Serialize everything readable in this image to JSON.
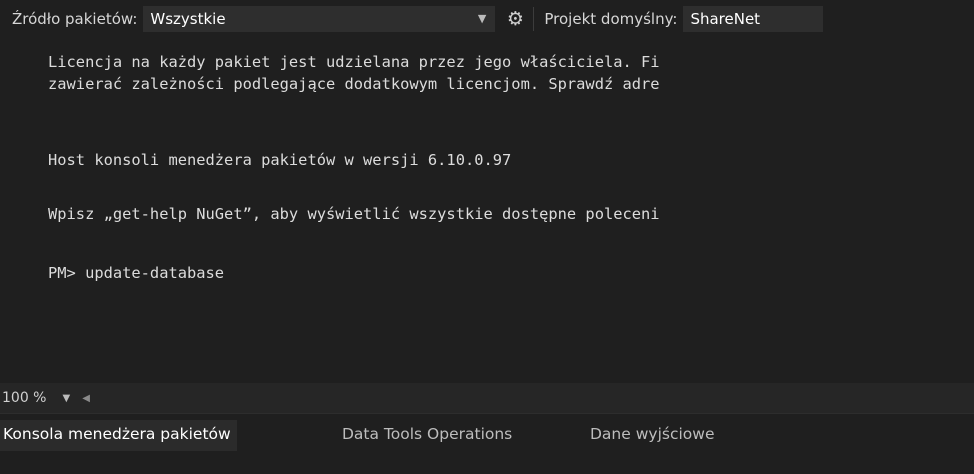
{
  "toolbar": {
    "source_label": "Źródło pakietów:",
    "source_value": "Wszystkie",
    "settings_icon": "gear-icon",
    "project_label": "Projekt domyślny:",
    "project_value": "ShareNet"
  },
  "console": {
    "lines": [
      "Licencja na każdy pakiet jest udzielana przez jego właściciela. Fi",
      "zawierać zależności podlegające dodatkowym licencjom. Sprawdź adre",
      "Host konsoli menedżera pakietów w wersji 6.10.0.97",
      "Wpisz „get-help NuGet”, aby wyświetlić wszystkie dostępne poleceni",
      "PM> update-database"
    ]
  },
  "zoombar": {
    "zoom": "100 %"
  },
  "tabs": [
    {
      "label": "Konsola menedżera pakietów",
      "active": true
    },
    {
      "label": "Data Tools Operations",
      "active": false
    },
    {
      "label": "Dane wyjściowe",
      "active": false
    }
  ],
  "colors": {
    "background": "#1f1f1f",
    "dropdown_bg": "#2e2e2e",
    "text": "#dcdcdc"
  }
}
